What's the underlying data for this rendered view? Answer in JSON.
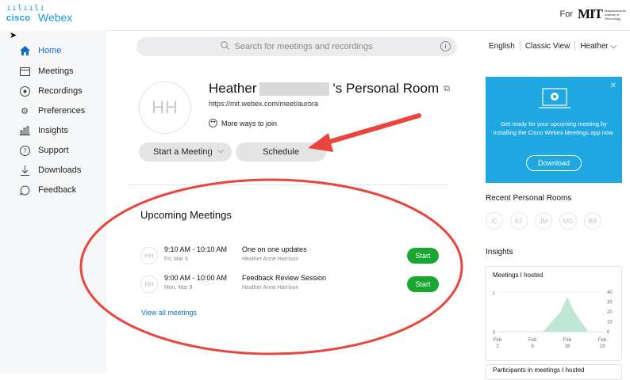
{
  "brand": {
    "cisco": "cisco",
    "product": "Webex",
    "for_label": "For",
    "org_mark": "MIT",
    "org_text": "Massachusetts Institute of Technology"
  },
  "sidebar": {
    "items": [
      {
        "label": "Home",
        "icon": "home-icon",
        "active": true
      },
      {
        "label": "Meetings",
        "icon": "calendar-icon"
      },
      {
        "label": "Recordings",
        "icon": "record-icon"
      },
      {
        "label": "Preferences",
        "icon": "gear-icon"
      },
      {
        "label": "Insights",
        "icon": "bar-chart-icon"
      },
      {
        "label": "Support",
        "icon": "help-icon"
      },
      {
        "label": "Downloads",
        "icon": "download-icon"
      },
      {
        "label": "Feedback",
        "icon": "feedback-icon"
      }
    ]
  },
  "search": {
    "placeholder": "Search for meetings and recordings"
  },
  "topnav": {
    "language": "English",
    "classic_view": "Classic View",
    "user_menu": "Heather"
  },
  "room": {
    "initials": "HH",
    "title_first": "Heather",
    "title_suffix": "'s Personal Room",
    "url": "https://mit.webex.com/meet/aurora",
    "more_ways": "More ways to join",
    "start_button": "Start a Meeting",
    "schedule_button": "Schedule"
  },
  "upcoming": {
    "title": "Upcoming Meetings",
    "meetings": [
      {
        "initials": "HH",
        "time": "9:10 AM - 10:10 AM",
        "date": "Fri, Mar 6",
        "name": "One on one updates",
        "host": "Heather Anne Harrison",
        "action": "Start"
      },
      {
        "initials": "HH",
        "time": "9:00 AM - 10:00 AM",
        "date": "Mon, Mar 9",
        "name": "Feedback Review Session",
        "host": "Heather Anne Harrison",
        "action": "Start"
      }
    ],
    "view_all": "View all meetings"
  },
  "promo": {
    "message": "Get ready for your upcoming meeting by installing the Cisco Webex Meetings app now.",
    "download": "Download"
  },
  "recent_rooms": {
    "title": "Recent Personal Rooms",
    "initials": [
      "IC",
      "KF",
      "JM",
      "MG",
      "BB"
    ]
  },
  "insights": {
    "title": "Insights",
    "card_title": "Meetings I hosted",
    "card2_title": "Participants in meetings I hosted"
  },
  "colors": {
    "accent": "#0a6ec4",
    "promo_bg": "#1ea7e1",
    "start_green": "#18a82f",
    "annotation_red": "#e8453c",
    "chart_fill": "#bfe7d6"
  },
  "chart_data": {
    "type": "area",
    "title": "Meetings I hosted",
    "x": [
      "Feb 2",
      "Feb 9",
      "Feb 16",
      "Feb 23"
    ],
    "x_tick_labels": [
      [
        "Feb",
        "2"
      ],
      [
        "Feb",
        "9"
      ],
      [
        "Feb",
        "16"
      ],
      [
        "Feb",
        "23"
      ]
    ],
    "left_axis_ticks": [
      "1",
      "0"
    ],
    "right_axis_ticks": [
      "40",
      "30",
      "20",
      "10",
      "0"
    ],
    "ylim": [
      0,
      40
    ],
    "series": [
      {
        "x": [
          0,
          1.3,
          1.8,
          2.0,
          2.2,
          2.6,
          3.0
        ],
        "values": [
          0,
          0,
          20,
          35,
          20,
          0,
          0
        ]
      }
    ]
  }
}
